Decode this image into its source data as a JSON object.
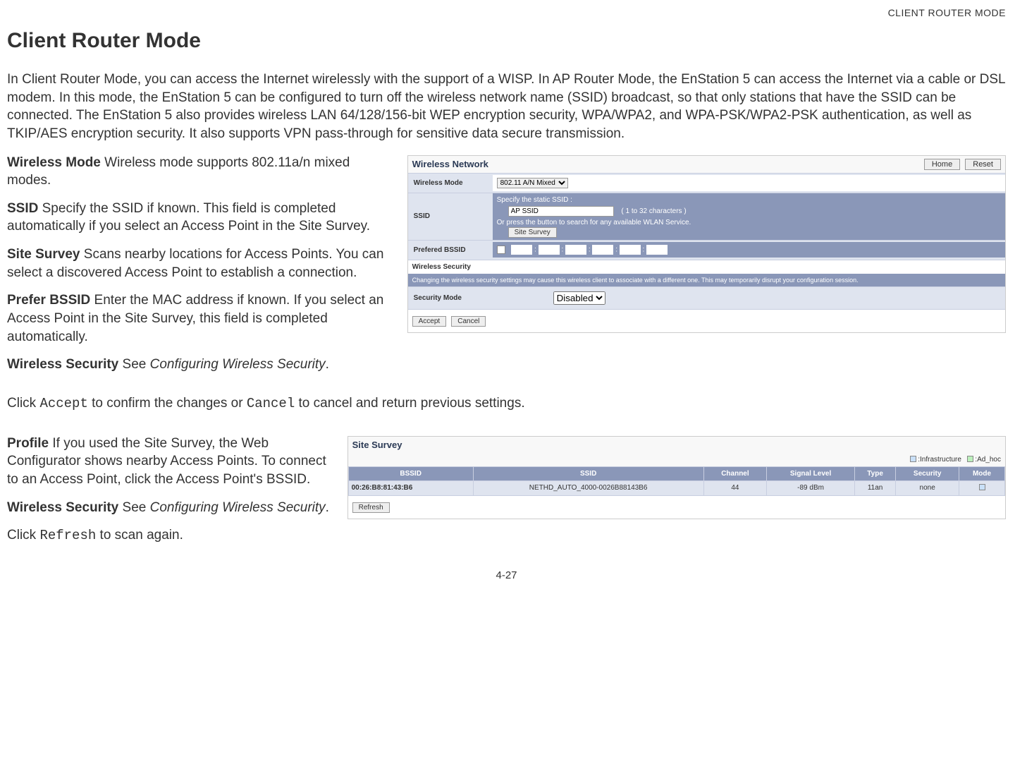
{
  "header_right": "CLIENT ROUTER MODE",
  "page_title": "Client Router Mode",
  "intro": "In Client Router Mode, you can access the Internet wirelessly with the support of a WISP. In AP Router Mode, the EnStation 5 can access the Internet via a cable or DSL modem. In this mode, the EnStation 5 can be configured to turn off the wireless network name (SSID) broadcast, so that only stations that have the SSID can be connected. The EnStation 5 also provides wireless LAN 64/128/156-bit WEP encryption security, WPA/WPA2, and WPA-PSK/WPA2-PSK authentication, as well as TKIP/AES encryption security. It also supports VPN pass-through for sensitive data secure transmission.",
  "defs1": {
    "wireless_mode": {
      "term": "Wireless Mode",
      "desc": "  Wireless mode supports 802.11a/n mixed modes."
    },
    "ssid": {
      "term": "SSID",
      "desc": "  Specify the SSID if known. This field is completed automatically if you select an Access Point in the Site Survey."
    },
    "site_survey": {
      "term": "Site Survey",
      "desc": "  Scans nearby locations for Access Points. You can select a discovered Access Point to establish a connection."
    },
    "prefer_bssid": {
      "term": "Prefer BSSID",
      "desc": "  Enter the MAC address if known. If you select an Access Point in the Site Survey, this field is completed automatically."
    },
    "wireless_security": {
      "term": "Wireless Security",
      "desc_prefix": "  See ",
      "desc_italic": "Configuring Wireless Security",
      "desc_suffix": "."
    }
  },
  "footer1": {
    "prefix": "Click ",
    "accept": "Accept",
    "mid": " to confirm the changes or ",
    "cancel": "Cancel",
    "suffix": " to cancel and return previous settings."
  },
  "defs2": {
    "profile": {
      "term": "Profile",
      "desc": "  If you used the Site Survey, the Web Configurator shows nearby Access Points. To connect to an Access Point, click the Access Point's BSSID."
    },
    "wireless_security": {
      "term": "Wireless Security",
      "desc_prefix": "  See ",
      "desc_italic": "Configuring Wireless Security",
      "desc_suffix": "."
    }
  },
  "footer2": {
    "prefix": "Click ",
    "refresh": "Refresh",
    "suffix": " to scan again."
  },
  "page_number": "4-27",
  "panel1": {
    "title": "Wireless Network",
    "home_btn": "Home",
    "reset_btn": "Reset",
    "wireless_mode_label": "Wireless Mode",
    "wireless_mode_value": "802.11 A/N Mixed",
    "ssid_label": "SSID",
    "ssid_static": "Specify the static SSID  :",
    "ssid_value": "AP SSID",
    "ssid_hint": "( 1 to 32 characters )",
    "ssid_or": "Or press the button to search for any available WLAN Service.",
    "site_survey_btn": "Site Survey",
    "prefered_bssid_label": "Prefered BSSID",
    "wsec_header": "Wireless Security",
    "warn": "Changing the wireless security settings may cause this wireless client to associate with a different one. This may temporarily disrupt your configuration session.",
    "security_mode_label": "Security Mode",
    "security_mode_value": "Disabled",
    "accept_btn": "Accept",
    "cancel_btn": "Cancel"
  },
  "panel2": {
    "title": "Site Survey",
    "legend_infra": ":Infrastructure",
    "legend_adhoc": ":Ad_hoc",
    "cols": [
      "BSSID",
      "SSID",
      "Channel",
      "Signal Level",
      "Type",
      "Security",
      "Mode"
    ],
    "row": {
      "bssid": "00:26:B8:81:43:B6",
      "ssid": "NETHD_AUTO_4000-0026B88143B6",
      "channel": "44",
      "signal": "-89 dBm",
      "type": "11an",
      "security": "none"
    },
    "refresh_btn": "Refresh"
  }
}
